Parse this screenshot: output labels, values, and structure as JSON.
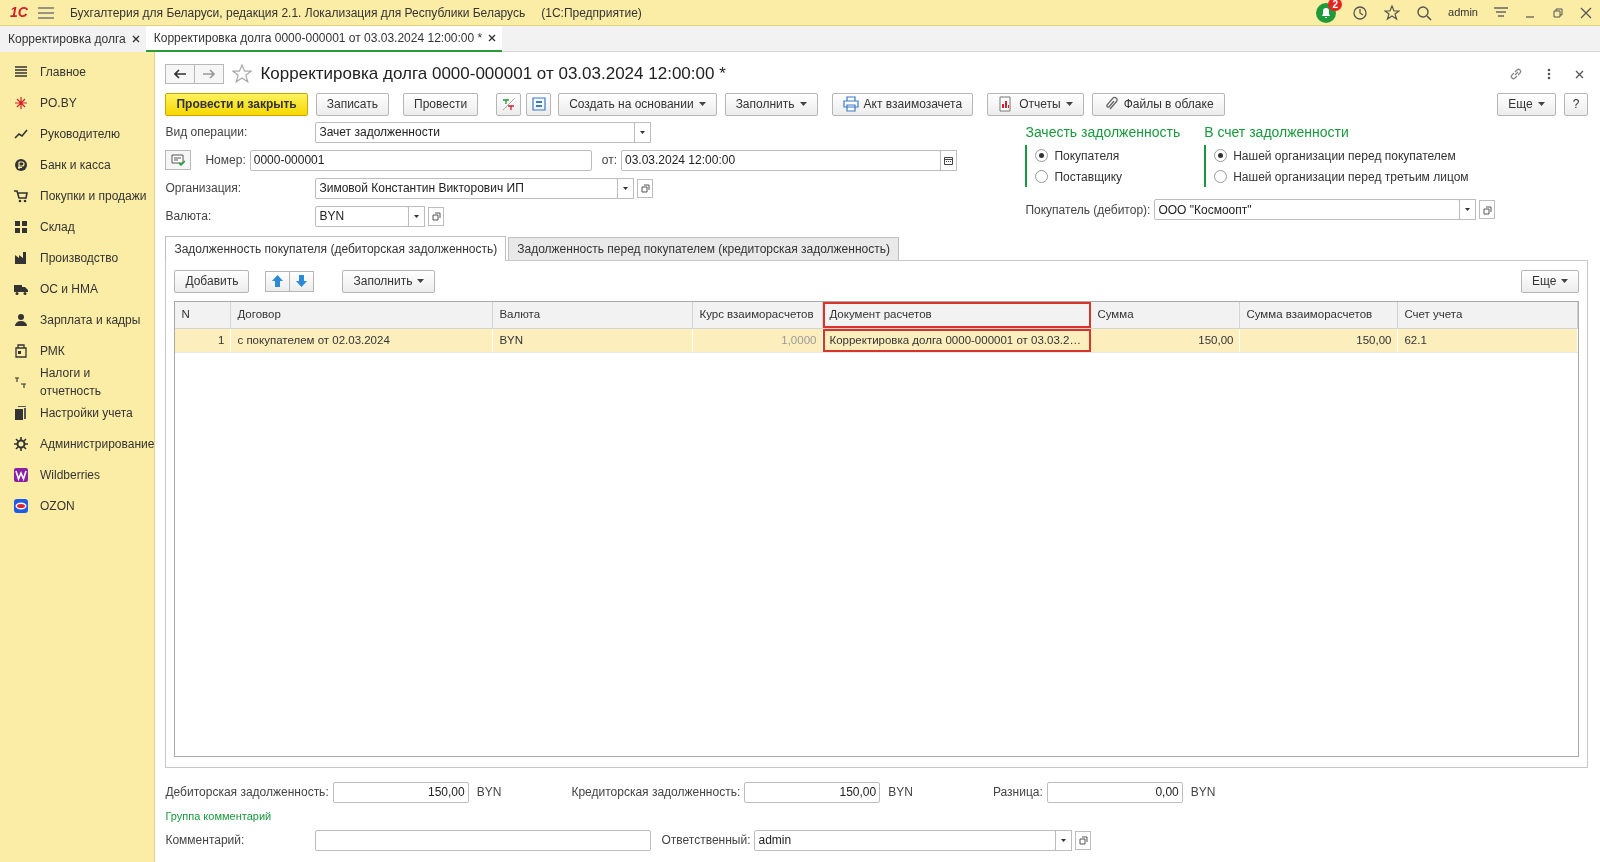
{
  "app": {
    "logo": "1С",
    "title": "Бухгалтерия для Беларуси, редакция 2.1. Локализация для Республики Беларусь",
    "platform": "(1С:Предприятие)",
    "notifications": "2",
    "user": "admin"
  },
  "window_tabs": [
    {
      "label": "Корректировка долга",
      "selected": false
    },
    {
      "label": "Корректировка долга 0000-000001 от 03.03.2024 12:00:00 *",
      "selected": true
    }
  ],
  "sidebar": {
    "items": [
      {
        "label": "Главное"
      },
      {
        "label": "PO.BY"
      },
      {
        "label": "Руководителю"
      },
      {
        "label": "Банк и касса"
      },
      {
        "label": "Покупки и продажи"
      },
      {
        "label": "Склад"
      },
      {
        "label": "Производство"
      },
      {
        "label": "ОС и НМА"
      },
      {
        "label": "Зарплата и кадры"
      },
      {
        "label": "РМК"
      },
      {
        "label": "Налоги и отчетность"
      },
      {
        "label": "Настройки учета"
      },
      {
        "label": "Администрирование"
      },
      {
        "label": "Wildberries"
      },
      {
        "label": "OZON"
      }
    ]
  },
  "form": {
    "title": "Корректировка долга 0000-000001 от 03.03.2024 12:00:00 *",
    "favorite": false
  },
  "toolbar": [
    {
      "kind": "primary",
      "label": "Провести и закрыть"
    },
    {
      "kind": "button",
      "label": "Записать"
    },
    {
      "kind": "button",
      "label": "Провести"
    },
    {
      "kind": "icon"
    },
    {
      "kind": "icon"
    },
    {
      "kind": "menu",
      "label": "Создать на основании"
    },
    {
      "kind": "menu",
      "label": "Заполнить"
    },
    {
      "kind": "button",
      "label": "Акт взаимозачета"
    },
    {
      "kind": "menu",
      "label": "Отчеты"
    },
    {
      "kind": "button",
      "label": "Файлы в облаке"
    }
  ],
  "toolbar_right": {
    "more": "Еще",
    "help": "?"
  },
  "operation": {
    "label": "Вид операции:",
    "value": "Зачет задолженности"
  },
  "number": {
    "label": "Номер:",
    "value": "0000-000001",
    "date_label": "от:",
    "date": "03.03.2024 12:00:00"
  },
  "organization": {
    "label": "Организация:",
    "value": "Зимовой Константин Викторович ИП"
  },
  "currency": {
    "label": "Валюта:",
    "value": "BYN"
  },
  "offset_debt": {
    "title": "Зачесть задолженность",
    "options": [
      {
        "label": "Покупателя",
        "selected": true
      },
      {
        "label": "Поставщику",
        "selected": false
      }
    ]
  },
  "against_debt": {
    "title": "В счет задолженности",
    "options": [
      {
        "label": "Нашей организации перед покупателем",
        "selected": true
      },
      {
        "label": "Нашей организации перед третьим лицом",
        "selected": false
      }
    ]
  },
  "buyer": {
    "label": "Покупатель (дебитор):",
    "value": "ООО \"Космоопт\""
  },
  "tabs": [
    {
      "label": "Задолженность покупателя (дебиторская задолженность)",
      "selected": true
    },
    {
      "label": "Задолженность перед покупателем (кредиторская задолженность)",
      "selected": false
    }
  ],
  "table_toolbar": {
    "add": "Добавить",
    "fill": "Заполнить",
    "more": "Еще"
  },
  "table": {
    "columns": [
      {
        "label": "N"
      },
      {
        "label": "Договор"
      },
      {
        "label": "Валюта"
      },
      {
        "label": "Курс взаиморасчетов",
        "readonly": true
      },
      {
        "label": "Документ расчетов",
        "highlighted": true
      },
      {
        "label": "Сумма"
      },
      {
        "label": "Сумма взаиморасчетов"
      },
      {
        "label": "Счет учета"
      }
    ],
    "rows": [
      {
        "selected": true,
        "cells": [
          "1",
          "с покупателем от 02.03.2024",
          "BYN",
          "1,0000",
          "Корректировка долга 0000-000001 от 03.03.2…",
          "150,00",
          "150,00",
          "62.1"
        ]
      }
    ]
  },
  "totals": [
    {
      "label": "Дебиторская задолженность:",
      "value": "150,00",
      "currency": "BYN"
    },
    {
      "label": "Кредиторская задолженность:",
      "value": "150,00",
      "currency": "BYN"
    },
    {
      "label": "Разница:",
      "value": "0,00",
      "currency": "BYN"
    }
  ],
  "comments": {
    "group_title": "Группа комментарий",
    "comment_label": "Комментарий:",
    "responsible_label": "Ответственный:",
    "responsible": "admin"
  }
}
